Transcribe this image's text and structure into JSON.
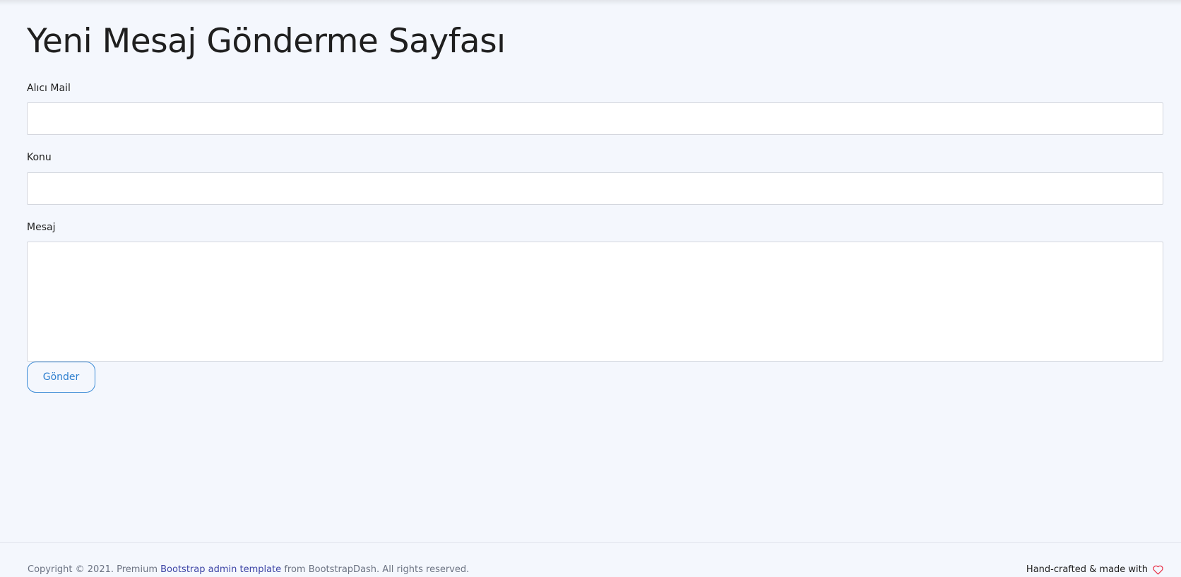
{
  "header": {
    "title": "Yeni Mesaj Gönderme Sayfası"
  },
  "form": {
    "recipient": {
      "label": "Alıcı Mail",
      "value": "",
      "placeholder": ""
    },
    "subject": {
      "label": "Konu",
      "value": "",
      "placeholder": ""
    },
    "message": {
      "label": "Mesaj",
      "value": "",
      "placeholder": ""
    },
    "submit_label": "Gönder"
  },
  "footer": {
    "copyright_prefix": "Copyright © 2021. Premium",
    "link_text": "Bootstrap admin template",
    "copyright_suffix": "from BootstrapDash. All rights reserved.",
    "made_with": "Hand-crafted & made with",
    "heart_icon": "heart-outline-icon"
  },
  "colors": {
    "background": "#f4f7fd",
    "button_accent": "#2e7fcf",
    "link": "#3d45a6",
    "heart": "#e8334a"
  }
}
